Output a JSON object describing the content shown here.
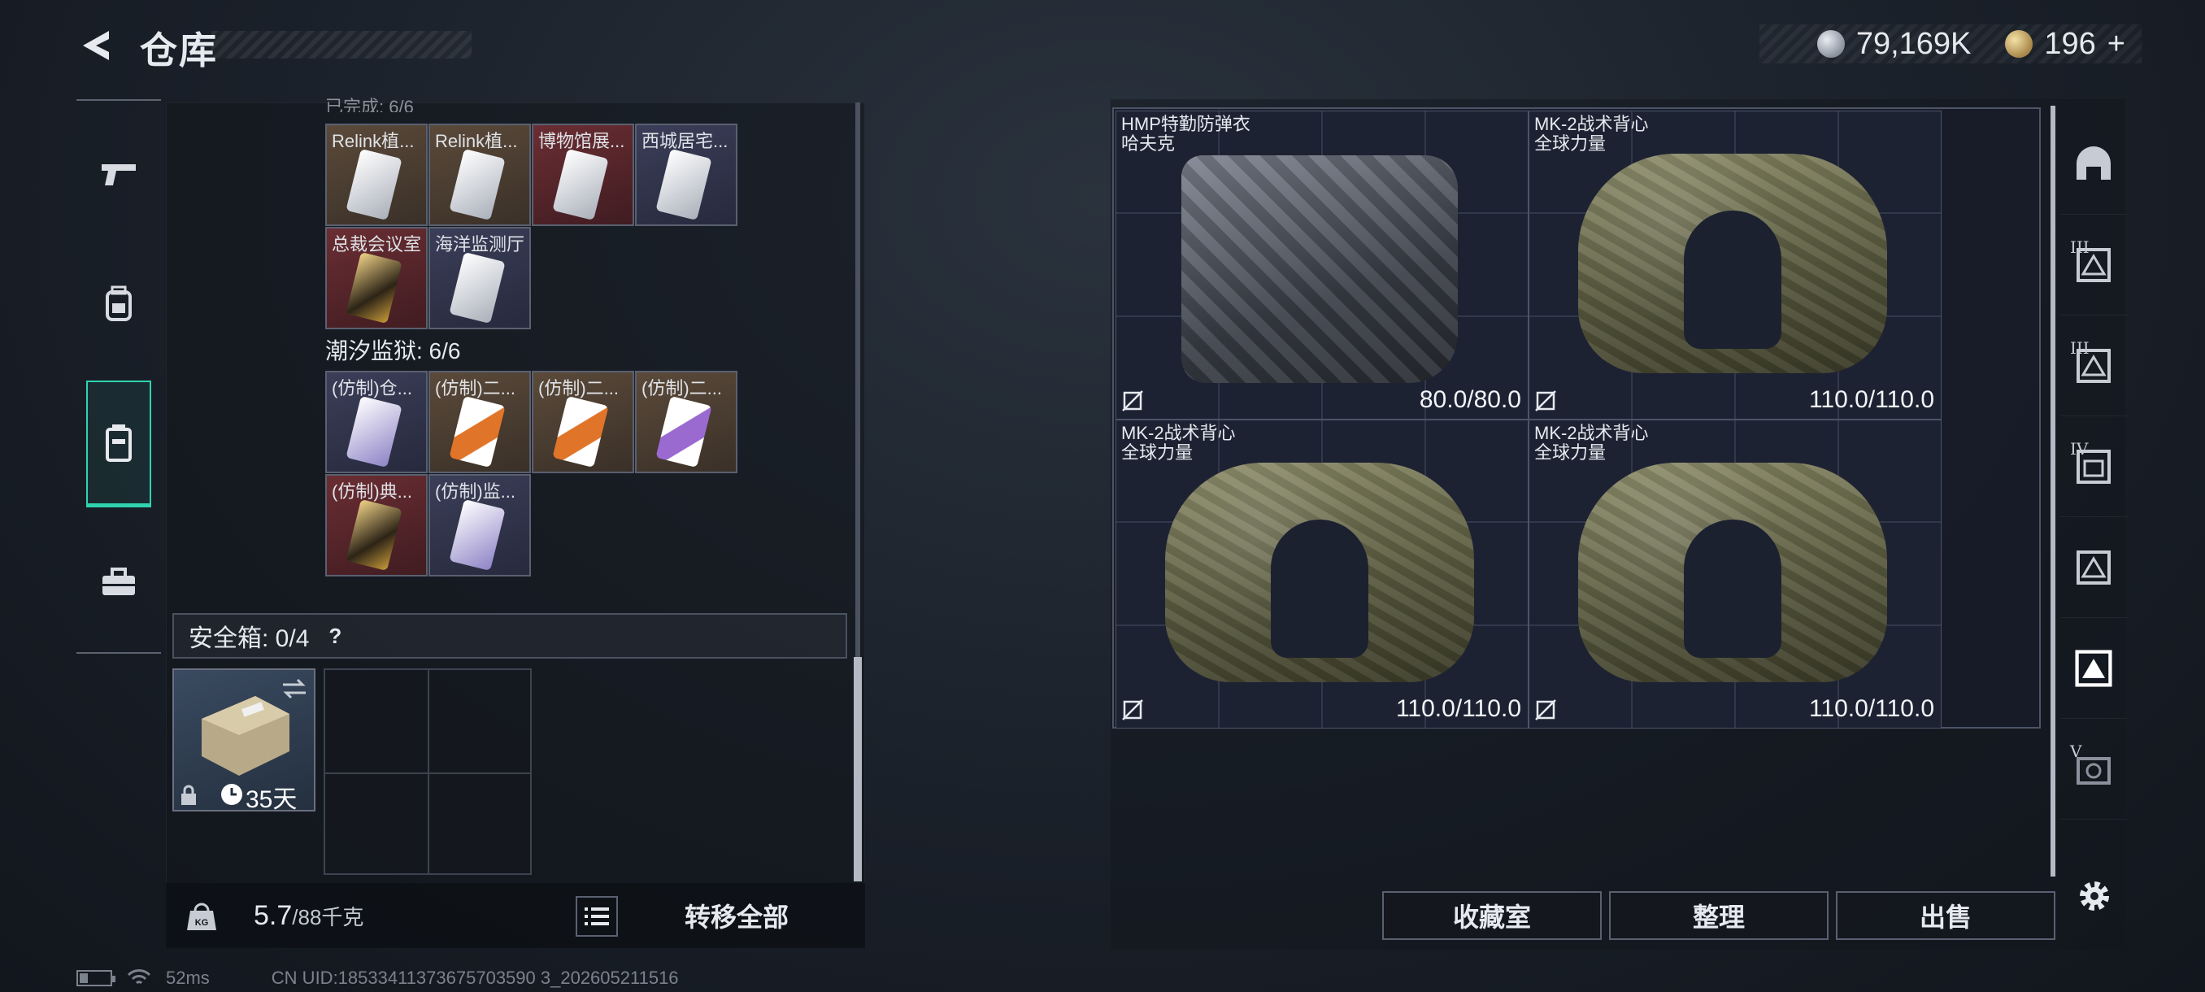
{
  "header": {
    "title": "仓库",
    "currency_silver": "79,169K",
    "currency_gold": "196",
    "add_label": "+"
  },
  "left_nav": [
    {
      "name": "weapons",
      "icon": "pistol-icon"
    },
    {
      "name": "gear",
      "icon": "backpack-icon"
    },
    {
      "name": "containers",
      "icon": "container-icon",
      "active": true
    },
    {
      "name": "toolbox",
      "icon": "toolbox-icon"
    }
  ],
  "keycards": {
    "cut_header": "已完成: 6/6",
    "group1": [
      {
        "label": "Relink植...",
        "bg": "brown",
        "card": "white"
      },
      {
        "label": "Relink植...",
        "bg": "brown",
        "card": "white"
      },
      {
        "label": "博物馆展...",
        "bg": "red",
        "card": "white"
      },
      {
        "label": "西城居宅...",
        "bg": "navy",
        "card": "white"
      },
      {
        "label": "总裁会议室",
        "bg": "red",
        "card": "gold"
      },
      {
        "label": "海洋监测厅",
        "bg": "navy",
        "card": "white"
      }
    ],
    "section2_title": "潮汐监狱: 6/6",
    "group2": [
      {
        "label": "(仿制)仓...",
        "bg": "navy",
        "card": "purple"
      },
      {
        "label": "(仿制)二...",
        "bg": "brown",
        "card": "orange"
      },
      {
        "label": "(仿制)二...",
        "bg": "brown",
        "card": "orange"
      },
      {
        "label": "(仿制)二...",
        "bg": "brown",
        "card": "violet"
      },
      {
        "label": "(仿制)典...",
        "bg": "red",
        "card": "gold"
      },
      {
        "label": "(仿制)监...",
        "bg": "navy",
        "card": "purple"
      }
    ]
  },
  "safe": {
    "label": "安全箱: 0/4",
    "help": "?",
    "timer": "35天"
  },
  "footer": {
    "weight_value": "5.7",
    "weight_max": "/88千克",
    "transfer_label": "转移全部"
  },
  "items": [
    {
      "name_line1": "HMP特勤防弹衣",
      "name_line2": "哈夫克",
      "durability": "80.0/80.0",
      "style": "gray"
    },
    {
      "name_line1": "MK-2战术背心",
      "name_line2": "全球力量",
      "durability": "110.0/110.0",
      "style": "green"
    },
    {
      "name_line1": "MK-2战术背心",
      "name_line2": "全球力量",
      "durability": "110.0/110.0",
      "style": "green"
    },
    {
      "name_line1": "MK-2战术背心",
      "name_line2": "全球力量",
      "durability": "110.0/110.0",
      "style": "green"
    }
  ],
  "side_tabs": [
    {
      "roman": "",
      "icon": "helmet-icon"
    },
    {
      "roman": "III",
      "icon": "vault-icon"
    },
    {
      "roman": "III",
      "icon": "vault-icon"
    },
    {
      "roman": "IV",
      "icon": "vault-icon"
    },
    {
      "roman": "",
      "icon": "vault-icon"
    },
    {
      "roman": "",
      "icon": "vault-icon",
      "active": true
    },
    {
      "roman": "V",
      "icon": "vault-icon"
    }
  ],
  "actions": {
    "collection": "收藏室",
    "sort": "整理",
    "sell": "出售"
  },
  "status": {
    "ping": "52ms",
    "uid": "CN UID:18533411373675703590 3_202605211516"
  },
  "colors": {
    "accent": "#2fd3b0",
    "panel": "#12161c",
    "border": "#5a6070"
  }
}
